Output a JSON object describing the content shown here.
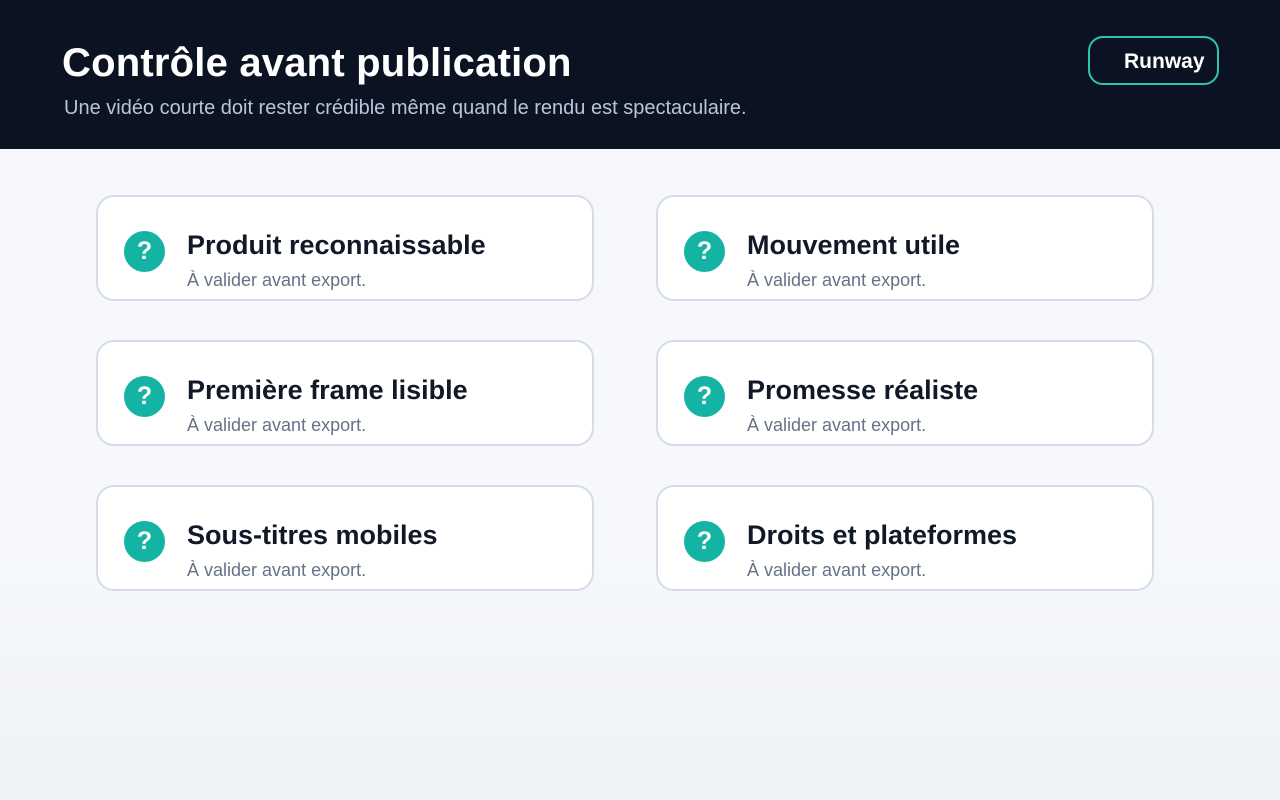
{
  "header": {
    "title": "Contrôle avant publication",
    "subtitle": "Une vidéo courte doit rester crédible même quand le rendu est spectaculaire.",
    "badge": "Runway"
  },
  "checklist": {
    "items": [
      {
        "title": "Produit reconnaissable",
        "status": "À valider avant export.",
        "icon": "question-icon",
        "icon_glyph": "?"
      },
      {
        "title": "Mouvement utile",
        "status": "À valider avant export.",
        "icon": "question-icon",
        "icon_glyph": "?"
      },
      {
        "title": "Première frame lisible",
        "status": "À valider avant export.",
        "icon": "question-icon",
        "icon_glyph": "?"
      },
      {
        "title": "Promesse réaliste",
        "status": "À valider avant export.",
        "icon": "question-icon",
        "icon_glyph": "?"
      },
      {
        "title": "Sous-titres mobiles",
        "status": "À valider avant export.",
        "icon": "question-icon",
        "icon_glyph": "?"
      },
      {
        "title": "Droits et plateformes",
        "status": "À valider avant export.",
        "icon": "question-icon",
        "icon_glyph": "?"
      }
    ]
  },
  "colors": {
    "header_bg": "#0b1221",
    "accent": "#15b3a4",
    "badge_border": "#2ec4b0",
    "card_border": "#d5dce7"
  }
}
